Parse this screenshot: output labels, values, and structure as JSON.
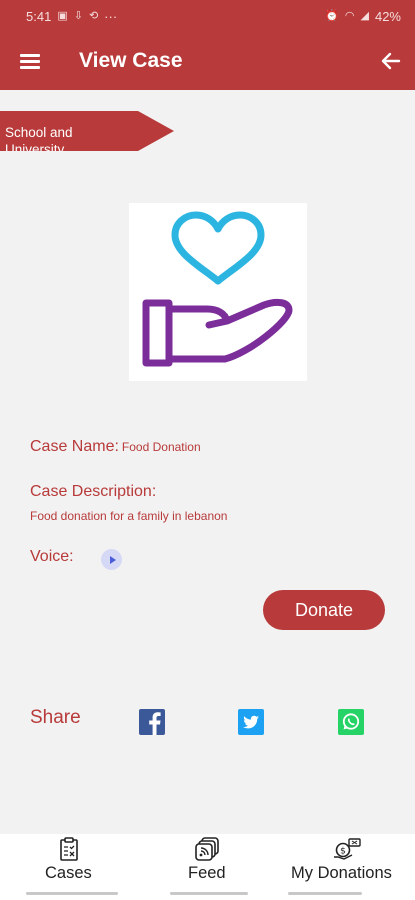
{
  "status_bar": {
    "time": "5:41",
    "battery": "42%",
    "overflow": "···"
  },
  "app_bar": {
    "title": "View Case",
    "menu_icon": "hamburger-menu-icon",
    "back_icon": "arrow-left-icon"
  },
  "category": {
    "label": "School and University"
  },
  "case": {
    "image_icon": "heart-in-hand-icon",
    "name_label": "Case Name:",
    "name_value": "Food Donation",
    "description_label": "Case Description:",
    "description_value": "Food donation for a family in lebanon",
    "voice_label": "Voice:",
    "voice_icon": "play-icon"
  },
  "actions": {
    "donate_label": "Donate"
  },
  "share": {
    "label": "Share",
    "icons": [
      "facebook-icon",
      "twitter-icon",
      "whatsapp-icon"
    ]
  },
  "bottom_nav": {
    "items": [
      {
        "label": "Cases",
        "icon": "clipboard-icon"
      },
      {
        "label": "Feed",
        "icon": "feed-icon"
      },
      {
        "label": "My Donations",
        "icon": "donation-icon"
      }
    ]
  },
  "colors": {
    "primary": "#b83a3a",
    "heart": "#2bb5e0",
    "hand": "#7b2e9a",
    "facebook": "#3b5998",
    "twitter": "#1da1f2",
    "whatsapp": "#25d366"
  }
}
